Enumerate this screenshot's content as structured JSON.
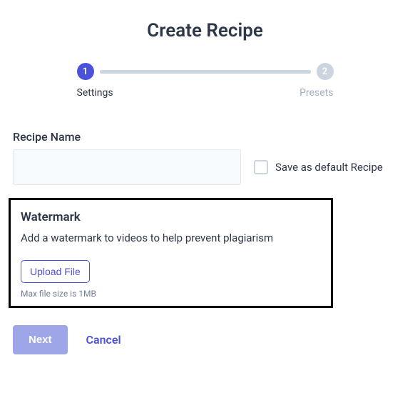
{
  "title": "Create Recipe",
  "stepper": {
    "steps": [
      {
        "num": "1",
        "label": "Settings",
        "active": true
      },
      {
        "num": "2",
        "label": "Presets",
        "active": false
      }
    ]
  },
  "recipe": {
    "name_label": "Recipe Name",
    "name_value": "",
    "save_default_label": "Save as default Recipe"
  },
  "watermark": {
    "title": "Watermark",
    "description": "Add a watermark to videos to help prevent plagiarism",
    "upload_label": "Upload File",
    "hint": "Max file size is 1MB"
  },
  "actions": {
    "next": "Next",
    "cancel": "Cancel"
  }
}
